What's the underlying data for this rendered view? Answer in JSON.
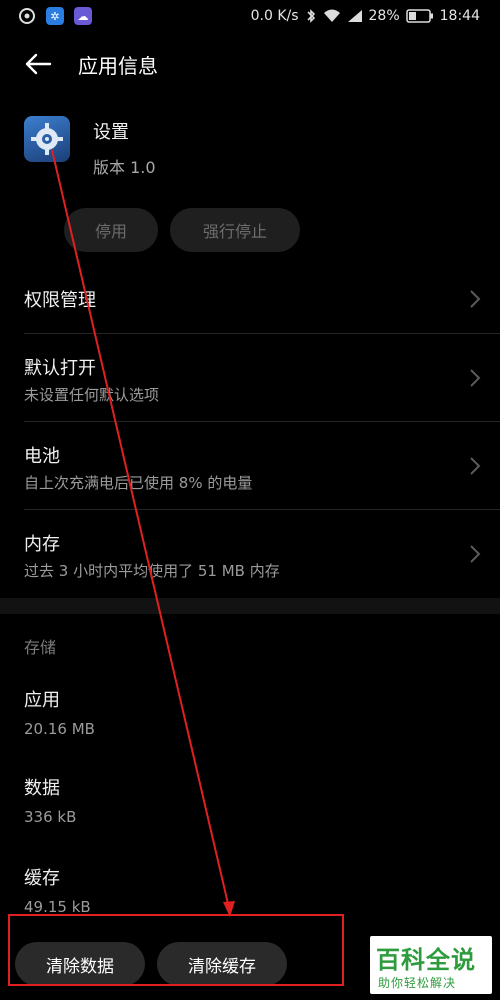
{
  "status_bar": {
    "network_speed": "0.0 K/s",
    "battery_percent": "28%",
    "time": "18:44"
  },
  "header": {
    "title": "应用信息"
  },
  "app": {
    "name": "设置",
    "version": "版本 1.0"
  },
  "actions": {
    "disable_label": "停用",
    "force_stop_label": "强行停止"
  },
  "list": {
    "items": [
      {
        "title": "权限管理",
        "subtitle": ""
      },
      {
        "title": "默认打开",
        "subtitle": "未设置任何默认选项"
      },
      {
        "title": "电池",
        "subtitle": "自上次充满电后已使用 8% 的电量"
      },
      {
        "title": "内存",
        "subtitle": "过去 3 小时内平均使用了 51 MB 内存"
      }
    ]
  },
  "storage": {
    "header": "存储",
    "items": [
      {
        "title": "应用",
        "value": "20.16 MB"
      },
      {
        "title": "数据",
        "value": "336 kB"
      },
      {
        "title": "缓存",
        "value": "49.15 kB"
      }
    ]
  },
  "bottom": {
    "clear_data_label": "清除数据",
    "clear_cache_label": "清除缓存"
  },
  "watermark": {
    "main": "百科全说",
    "sub": "助你轻松解决"
  },
  "colors": {
    "background": "#000000",
    "annotation_red": "#e02020",
    "watermark_green": "#2e9c3e"
  }
}
